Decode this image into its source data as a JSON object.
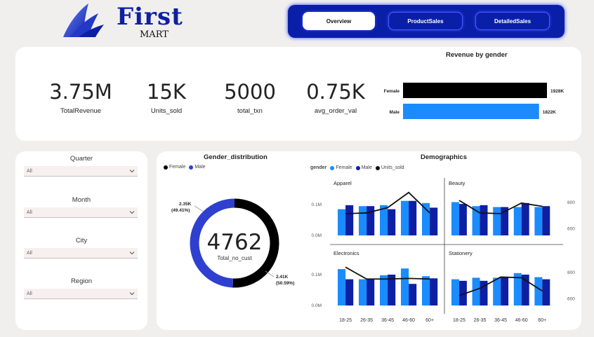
{
  "brand": {
    "name": "First",
    "sub": "MART"
  },
  "nav": {
    "tabs": [
      "Overview",
      "ProductSales",
      "DetailedSales"
    ],
    "active": 0
  },
  "kpis": [
    {
      "value": "3.75M",
      "label": "TotalRevenue"
    },
    {
      "value": "15K",
      "label": "Units_sold"
    },
    {
      "value": "5000",
      "label": "total_txn"
    },
    {
      "value": "0.75K",
      "label": "avg_order_val"
    }
  ],
  "filters": [
    {
      "label": "Quarter",
      "value": "All"
    },
    {
      "label": "Month",
      "value": "All"
    },
    {
      "label": "City",
      "value": "All"
    },
    {
      "label": "Region",
      "value": "All"
    }
  ],
  "colors": {
    "female": "#1a8cff",
    "male": "#0d1fa3",
    "units_line": "#111111",
    "nav_bg": "#0a1fa8"
  },
  "chart_data": [
    {
      "type": "bar",
      "title": "Revenue by gender",
      "orientation": "horizontal",
      "categories": [
        "Female",
        "Male"
      ],
      "values": [
        1928,
        1822
      ],
      "data_labels": [
        "1928K",
        "1822K"
      ],
      "bar_colors": [
        "#000000",
        "#1a8cff"
      ]
    },
    {
      "type": "pie",
      "title": "Gender_distribution",
      "donut": true,
      "legend": [
        "Female",
        "Male"
      ],
      "slices": [
        {
          "name": "Female",
          "value": 2.41,
          "label": "2.41K",
          "pct": "(50.59%)",
          "color": "#000000"
        },
        {
          "name": "Male",
          "value": 2.35,
          "label": "2.35K",
          "pct": "(49.41%)",
          "color": "#2f3fd0"
        }
      ],
      "center_value": "4762",
      "center_label": "Total_no_cust"
    },
    {
      "type": "bar",
      "title": "Demographics",
      "legend_title": "gender",
      "legend": [
        "Female",
        "Male",
        "Units_sold"
      ],
      "categories": [
        "18-25",
        "26-35",
        "36-45",
        "46-60",
        "60+"
      ],
      "left_ticks": [
        "0.0M",
        "0.1M"
      ],
      "right_ticks": [
        "600",
        "800"
      ],
      "ylim": [
        0,
        0.15
      ],
      "y2lim": [
        550,
        900
      ],
      "panels": [
        {
          "name": "Apparel",
          "female": [
            0.085,
            0.095,
            0.098,
            0.112,
            0.105
          ],
          "male": [
            0.098,
            0.095,
            0.085,
            0.112,
            0.09
          ],
          "units_sold": [
            715,
            720,
            760,
            875,
            720
          ]
        },
        {
          "name": "Beauty",
          "female": [
            0.108,
            0.095,
            0.092,
            0.092,
            0.092
          ],
          "male": [
            0.102,
            0.098,
            0.092,
            0.105,
            0.095
          ],
          "units_sold": [
            815,
            720,
            715,
            795,
            770
          ]
        },
        {
          "name": "Electronics",
          "female": [
            0.118,
            0.085,
            0.098,
            0.12,
            0.095
          ],
          "male": [
            0.085,
            0.085,
            0.1,
            0.07,
            0.088
          ],
          "units_sold": [
            840,
            750,
            750,
            755,
            750
          ]
        },
        {
          "name": "Stationery",
          "female": [
            0.085,
            0.09,
            0.09,
            0.105,
            0.092
          ],
          "male": [
            0.08,
            0.08,
            0.09,
            0.1,
            0.085
          ],
          "units_sold": [
            625,
            680,
            765,
            760,
            660
          ]
        }
      ]
    }
  ]
}
